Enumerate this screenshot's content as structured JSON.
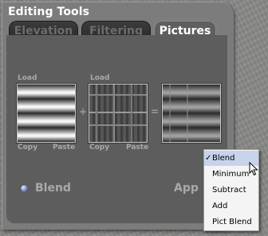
{
  "panel": {
    "title": "Editing Tools",
    "tabs": [
      {
        "label": "Elevation",
        "active": false
      },
      {
        "label": "Filtering",
        "active": false
      },
      {
        "label": "Pictures",
        "active": true
      }
    ]
  },
  "pictures": {
    "source_a": {
      "load": "Load",
      "copy": "Copy",
      "paste": "Paste"
    },
    "source_b": {
      "load": "Load",
      "copy": "Copy",
      "paste": "Paste"
    },
    "plus": "+",
    "equals": "="
  },
  "blend_option": {
    "label": "Blend"
  },
  "apply_button": {
    "label": "App"
  },
  "menu": {
    "items": [
      "Blend",
      "Minimum",
      "Subtract",
      "Add",
      "Pict Blend"
    ],
    "selected": "Blend",
    "check": "✓"
  },
  "colors": {
    "panel": "#7c7c7c",
    "content": "#5d5d5d",
    "menu_highlight": "#c6d3ea"
  }
}
